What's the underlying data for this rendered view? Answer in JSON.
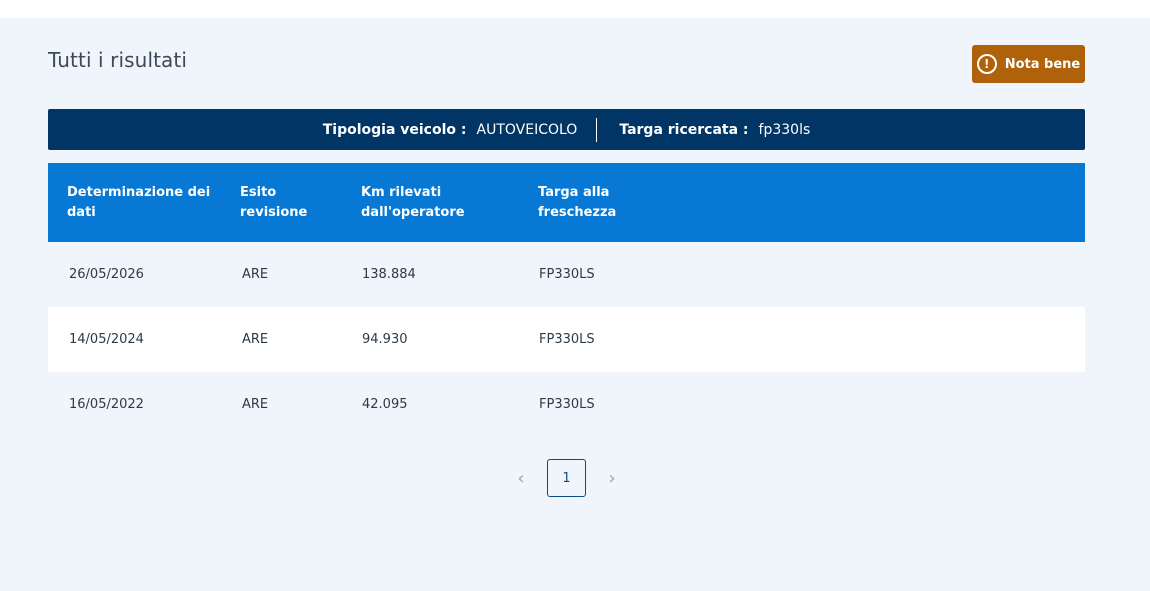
{
  "page": {
    "title": "Tutti i risultati"
  },
  "nota_button": {
    "label": "Nota bene",
    "icon": "!"
  },
  "info_bar": {
    "tipologia_label": "Tipologia veicolo :",
    "tipologia_value": "AUTOVEICOLO",
    "targa_label": "Targa ricercata :",
    "targa_value": "fp330ls"
  },
  "table": {
    "headers": [
      "Determinazione dei dati",
      "Esito revisione",
      "Km rilevati dall'operatore",
      "Targa alla freschezza"
    ],
    "rows": [
      [
        "26/05/2026",
        "ARE",
        "138.884",
        "FP330LS"
      ],
      [
        "14/05/2024",
        "ARE",
        "94.930",
        "FP330LS"
      ],
      [
        "16/05/2022",
        "ARE",
        "42.095",
        "FP330LS"
      ]
    ]
  },
  "pagination": {
    "prev": "‹",
    "current": "1",
    "next": "›"
  },
  "colors": {
    "header": "#0779d4",
    "info_bar": "#003566",
    "nota": "#b0620a",
    "background": "#eff5fa"
  }
}
